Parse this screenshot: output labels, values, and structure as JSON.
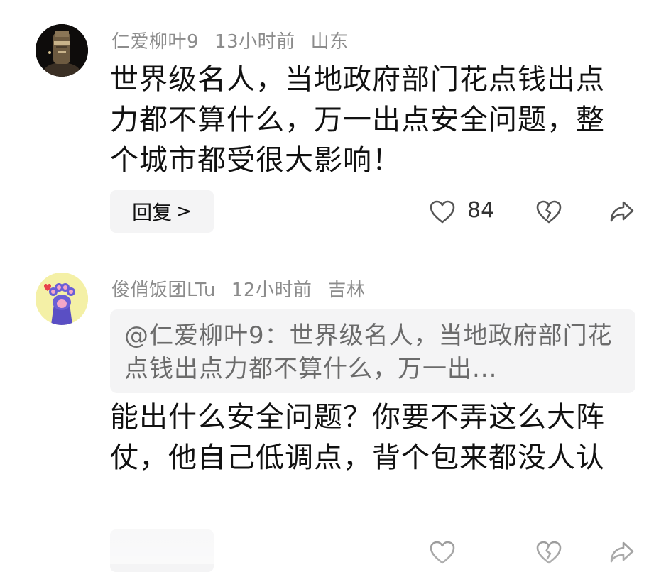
{
  "comments": [
    {
      "username": "仁爱柳叶9",
      "time": "13小时前",
      "location": "山东",
      "text": "世界级名人，当地政府部门花点钱出点力都不算什么，万一出点安全问题，整个城市都受很大影响！",
      "reply_label": "回复",
      "reply_chevron": ">",
      "likes": "84",
      "avatar_icon": "statue-portrait-avatar"
    },
    {
      "username": "俊俏饭团LTu",
      "time": "12小时前",
      "location": "吉林",
      "quote": "@仁爱柳叶9：世界级名人，当地政府部门花点钱出点力都不算什么，万一出...",
      "text": "能出什么安全问题？你要不弄这么大阵仗，他自己低调点，背个包来都没人认",
      "avatar_icon": "cat-paw-avatar"
    }
  ],
  "colors": {
    "username": "#8c8c8c",
    "body": "#111111",
    "quote_bg": "#f4f4f5",
    "quote_text": "#6b6b6b",
    "icon": "#555555"
  }
}
